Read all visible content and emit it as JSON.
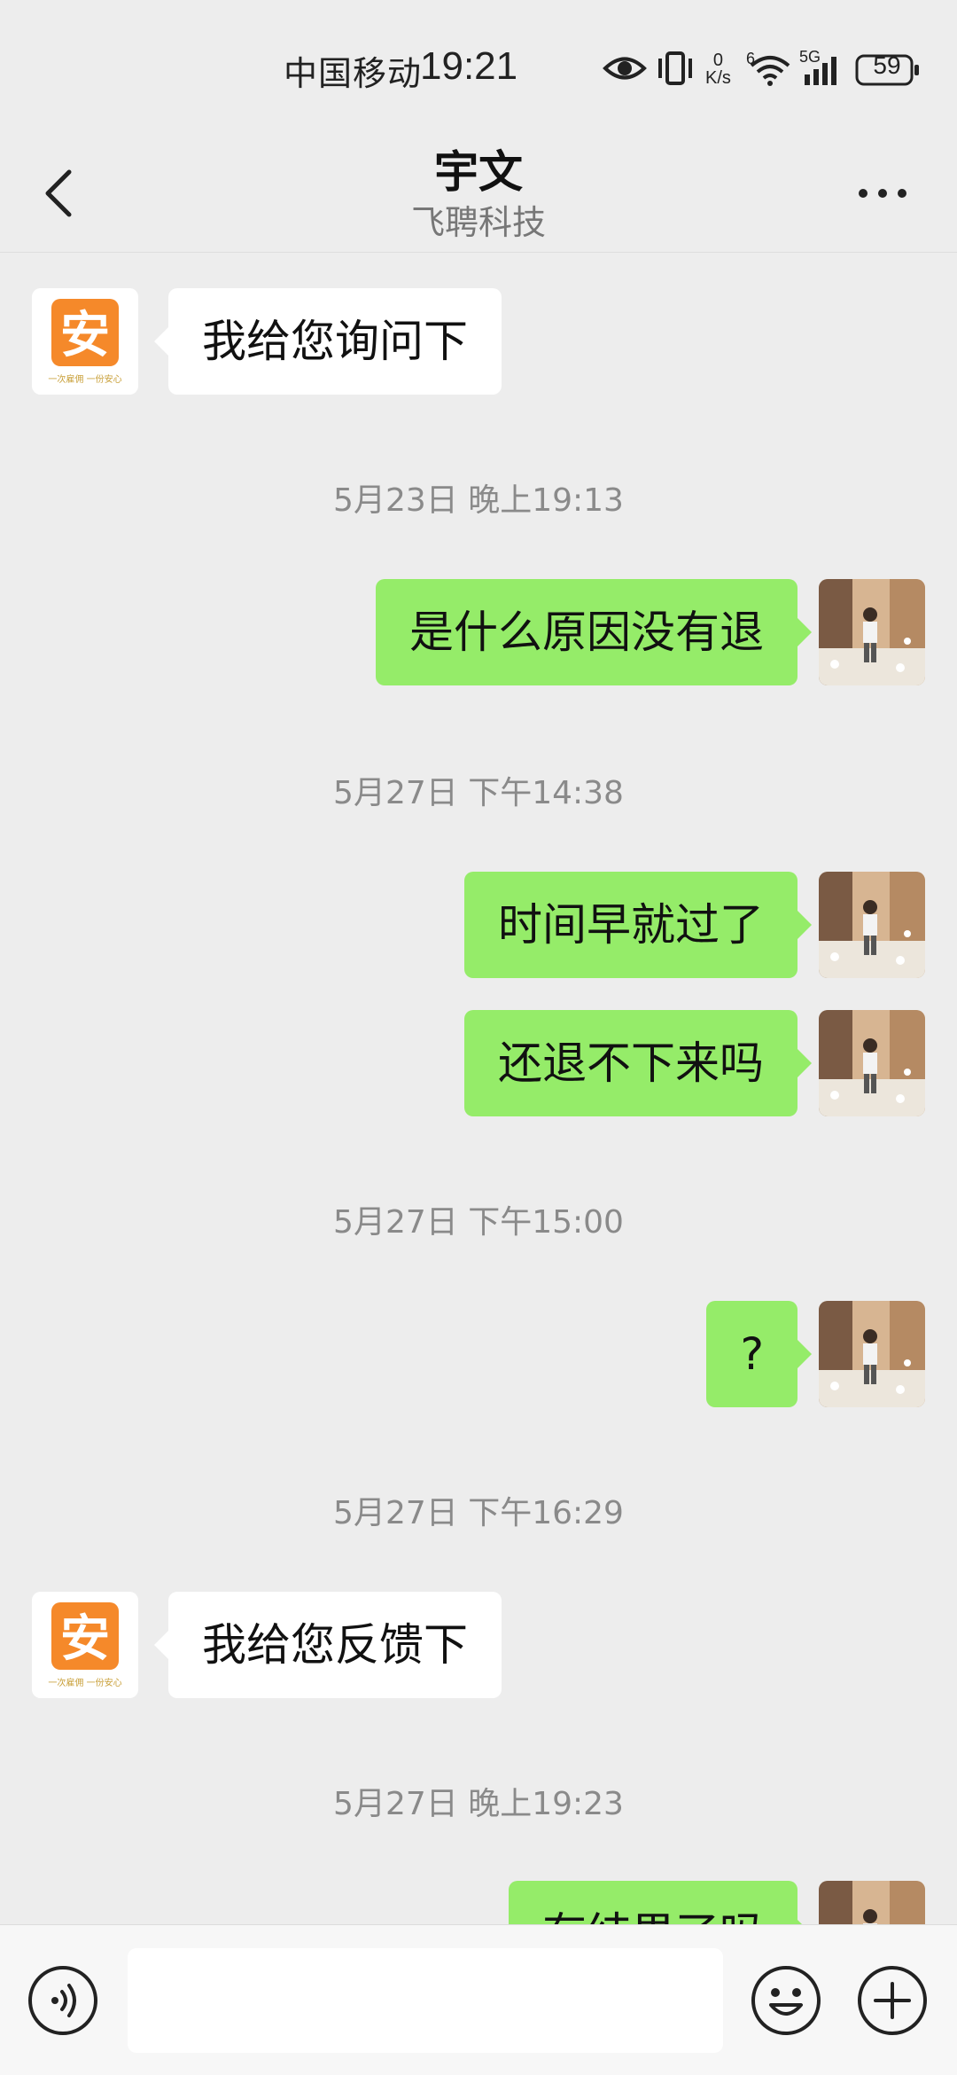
{
  "status_bar": {
    "carrier": "中国移动",
    "time": "19:21",
    "net_speed_value": "0",
    "net_speed_unit": "K/s",
    "wifi_label": "6",
    "cell_label": "5G",
    "battery": "59"
  },
  "header": {
    "title": "宇文",
    "subtitle": "飞聘科技"
  },
  "avatars": {
    "contact_logo_char": "安",
    "contact_logo_tagline": "一次雇佣 一份安心"
  },
  "messages": [
    {
      "type": "message",
      "direction": "in",
      "text": "我给您询问下"
    },
    {
      "type": "time",
      "text": "5月23日 晚上19:13"
    },
    {
      "type": "message",
      "direction": "out",
      "text": "是什么原因没有退"
    },
    {
      "type": "time",
      "text": "5月27日 下午14:38"
    },
    {
      "type": "message",
      "direction": "out",
      "text": "时间早就过了"
    },
    {
      "type": "message",
      "direction": "out",
      "text": "还退不下来吗"
    },
    {
      "type": "time",
      "text": "5月27日 下午15:00"
    },
    {
      "type": "message",
      "direction": "out",
      "text": "?"
    },
    {
      "type": "time",
      "text": "5月27日 下午16:29"
    },
    {
      "type": "message",
      "direction": "in",
      "text": "我给您反馈下"
    },
    {
      "type": "time",
      "text": "5月27日 晚上19:23"
    },
    {
      "type": "message",
      "direction": "out",
      "text": "有结果了吗"
    }
  ],
  "input": {
    "placeholder": ""
  },
  "colors": {
    "background": "#ededed",
    "outgoing_bubble": "#95ec69",
    "incoming_bubble": "#ffffff",
    "logo_orange": "#f5892a"
  },
  "icons": {
    "back": "chevron-left-icon",
    "more": "more-horizontal-icon",
    "voice": "voice-icon",
    "emoji": "emoji-icon",
    "plus": "plus-icon"
  }
}
